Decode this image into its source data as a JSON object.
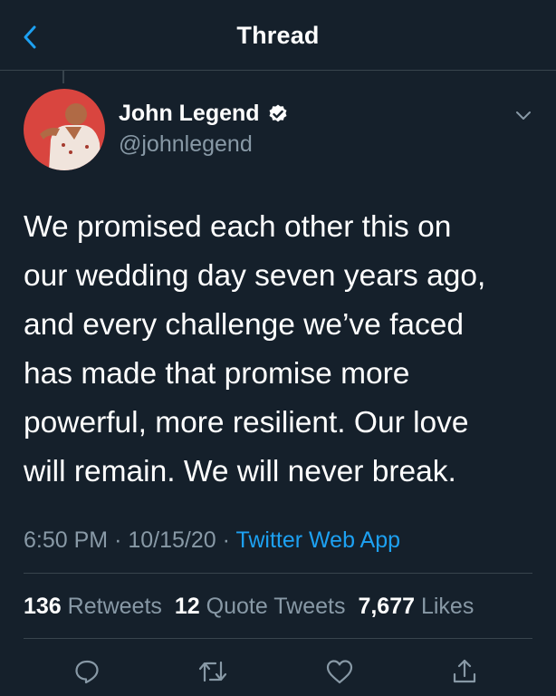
{
  "header": {
    "title": "Thread",
    "back_icon": "chevron-left-icon"
  },
  "tweet": {
    "author_name": "John Legend",
    "handle": "@johnlegend",
    "verified": true,
    "text_lines": [
      "We promised each other this on",
      "our wedding day seven years ago,",
      "and every challenge we’ve faced",
      "has made that promise more",
      "powerful, more resilient.  Our love",
      "will remain. We will never break."
    ],
    "time": "6:50 PM",
    "date": "10/15/20",
    "separator": "·",
    "source": "Twitter Web App"
  },
  "stats": {
    "retweets_count": "136",
    "retweets_label": "Retweets",
    "quotes_count": "12",
    "quotes_label": "Quote Tweets",
    "likes_count": "7,677",
    "likes_label": "Likes"
  },
  "actions": [
    "reply-icon",
    "retweet-icon",
    "like-icon",
    "share-icon"
  ],
  "colors": {
    "background": "#15202b",
    "accent": "#1da1f2",
    "secondary_text": "#8899a6",
    "divider": "#38444d"
  }
}
